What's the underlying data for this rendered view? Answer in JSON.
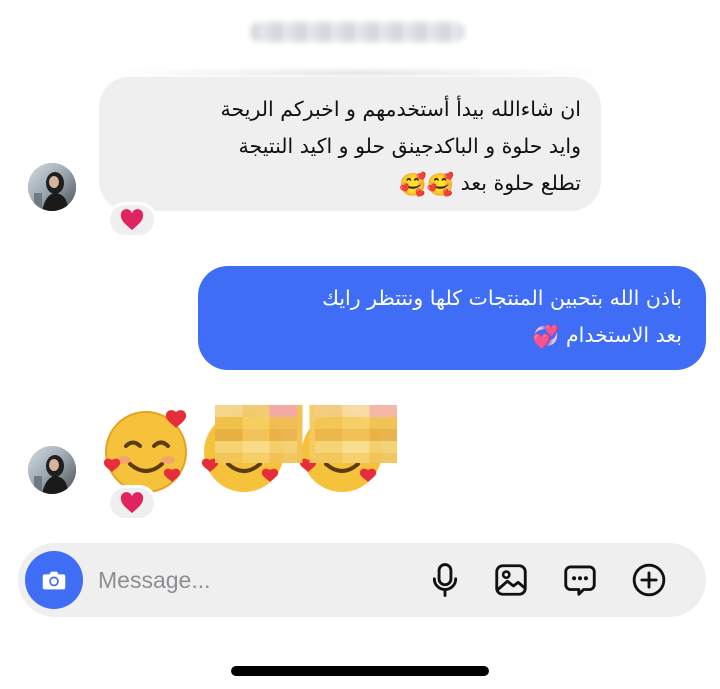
{
  "received": {
    "lines": [
      "ان شاءالله بيدأ أستخدمهم و اخبركم الريحة",
      "وايد حلوة و الباكدجينق حلو و اكيد النتيجة",
      "تطلع حلوة بعد"
    ],
    "emoji": "🥰🥰",
    "reaction": "❤️"
  },
  "sent": {
    "lines": [
      "باذن الله بتحبين المنتجات كلها ونتتظر رايك",
      "بعد الاستخدام"
    ],
    "emoji": "💞"
  },
  "emoji_message": {
    "emoji": [
      "🥰",
      "🥰",
      "🥰"
    ],
    "reaction": "❤️"
  },
  "composer": {
    "placeholder": "Message...",
    "camera_icon": "camera-icon",
    "icons": [
      "microphone-icon",
      "image-icon",
      "sticker-chat-icon",
      "plus-icon"
    ],
    "accent": "#3f6df6"
  },
  "colors": {
    "sent_bubble": "#3f6df6",
    "received_bubble": "#efefef",
    "reaction_heart": "#e0245e"
  }
}
